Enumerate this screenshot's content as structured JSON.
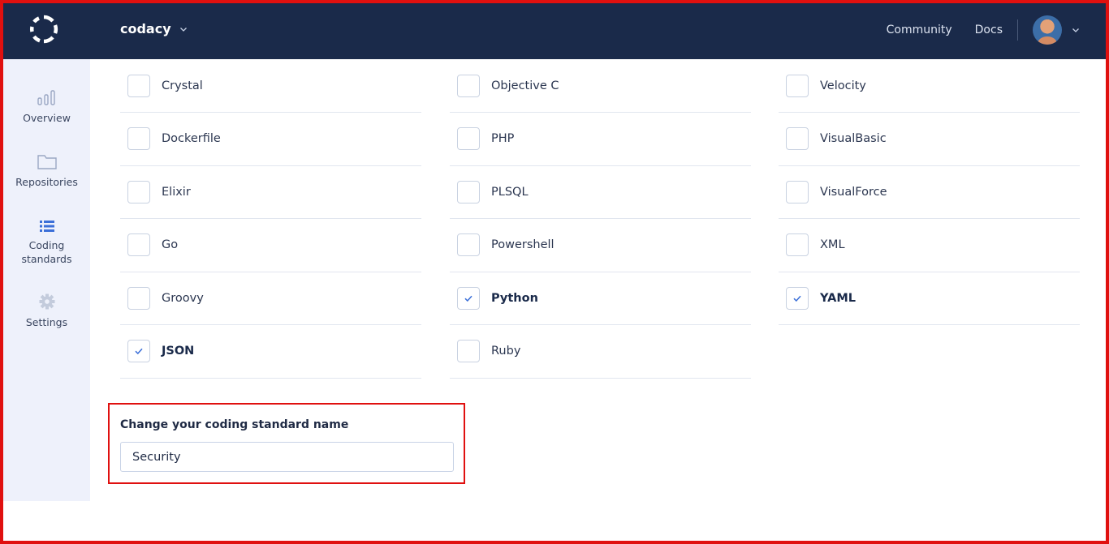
{
  "header": {
    "org_name": "codacy",
    "links": [
      "Community",
      "Docs"
    ]
  },
  "sidebar": {
    "items": [
      {
        "label": "Overview",
        "icon": "bar-chart-icon",
        "active": false
      },
      {
        "label": "Repositories",
        "icon": "folder-icon",
        "active": false
      },
      {
        "label": "Coding standards",
        "icon": "list-icon",
        "active": true
      },
      {
        "label": "Settings",
        "icon": "gear-icon",
        "active": false
      }
    ]
  },
  "languages": {
    "column1": [
      {
        "name": "Crystal",
        "checked": false
      },
      {
        "name": "Dockerfile",
        "checked": false
      },
      {
        "name": "Elixir",
        "checked": false
      },
      {
        "name": "Go",
        "checked": false
      },
      {
        "name": "Groovy",
        "checked": false
      },
      {
        "name": "JSON",
        "checked": true
      }
    ],
    "column2": [
      {
        "name": "Objective C",
        "checked": false
      },
      {
        "name": "PHP",
        "checked": false
      },
      {
        "name": "PLSQL",
        "checked": false
      },
      {
        "name": "Powershell",
        "checked": false
      },
      {
        "name": "Python",
        "checked": true
      },
      {
        "name": "Ruby",
        "checked": false
      }
    ],
    "column3": [
      {
        "name": "Velocity",
        "checked": false
      },
      {
        "name": "VisualBasic",
        "checked": false
      },
      {
        "name": "VisualForce",
        "checked": false
      },
      {
        "name": "XML",
        "checked": false
      },
      {
        "name": "YAML",
        "checked": true
      }
    ]
  },
  "name_section": {
    "title": "Change your coding standard name",
    "value": "Security"
  },
  "colors": {
    "topbar": "#1a2a4a",
    "sidebar": "#eef1fb",
    "accent": "#3b6fd8",
    "highlight_border": "#e0100f"
  }
}
